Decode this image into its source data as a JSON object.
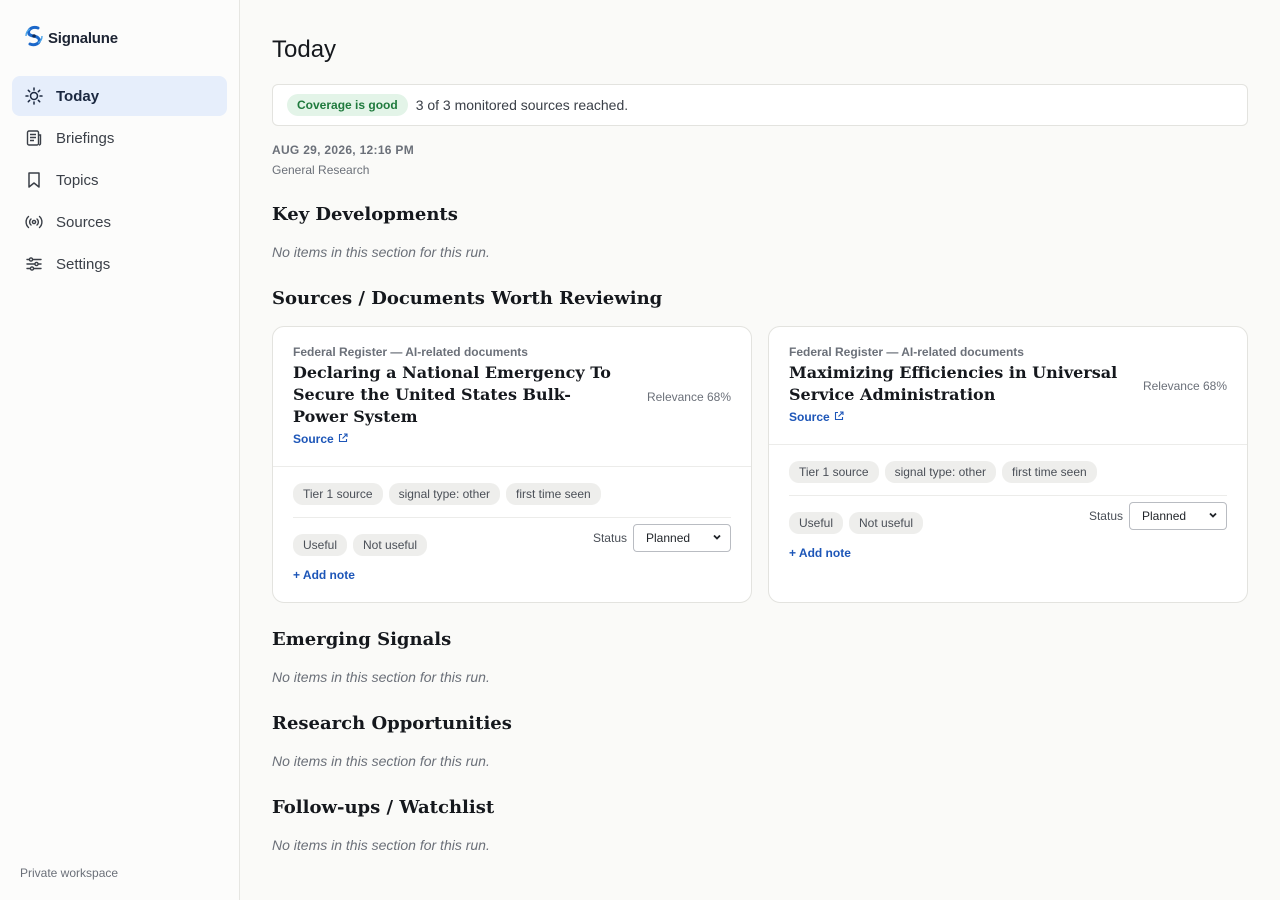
{
  "brand": {
    "name": "Signalune",
    "icon": "signalune-logo"
  },
  "sidebar": {
    "items": [
      {
        "label": "Today",
        "icon": "sun-icon",
        "active": true
      },
      {
        "label": "Briefings",
        "icon": "newspaper-icon"
      },
      {
        "label": "Topics",
        "icon": "bookmark-icon"
      },
      {
        "label": "Sources",
        "icon": "broadcast-icon"
      },
      {
        "label": "Settings",
        "icon": "sliders-icon"
      }
    ],
    "footer": "Private workspace"
  },
  "page": {
    "title": "Today"
  },
  "coverage": {
    "badge": "Coverage is good",
    "text": "3 of 3 monitored sources reached."
  },
  "run": {
    "date": "AUG 29, 2026, 12:16 PM",
    "profile": "General Research"
  },
  "sections": {
    "key_developments": {
      "title": "Key Developments",
      "empty": "No items in this section for this run."
    },
    "sources_docs": {
      "title": "Sources / Documents Worth Reviewing"
    },
    "emerging_signals": {
      "title": "Emerging Signals",
      "empty": "No items in this section for this run."
    },
    "research_opportunities": {
      "title": "Research Opportunities",
      "empty": "No items in this section for this run."
    },
    "followups": {
      "title": "Follow-ups / Watchlist",
      "empty": "No items in this section for this run."
    }
  },
  "cards": [
    {
      "source": "Federal Register — AI-related documents",
      "title": "Declaring a National Emergency To Secure the United States Bulk-Power System",
      "link_label": "Source",
      "relevance": "Relevance 68%",
      "chips": [
        "Tier 1 source",
        "signal type: other",
        "first time seen"
      ],
      "useful": "Useful",
      "not_useful": "Not useful",
      "status_label": "Status",
      "status_value": "Planned",
      "add_note": "+ Add note"
    },
    {
      "source": "Federal Register — AI-related documents",
      "title": "Maximizing Efficiencies in Universal Service Administration",
      "link_label": "Source",
      "relevance": "Relevance 68%",
      "chips": [
        "Tier 1 source",
        "signal type: other",
        "first time seen"
      ],
      "useful": "Useful",
      "not_useful": "Not useful",
      "status_label": "Status",
      "status_value": "Planned",
      "add_note": "+ Add note"
    }
  ],
  "colors": {
    "accent": "#1d56b8",
    "active_nav_bg": "#e6eefb",
    "good_badge_bg": "#e3f4e8",
    "good_badge_fg": "#1f7a3d"
  }
}
